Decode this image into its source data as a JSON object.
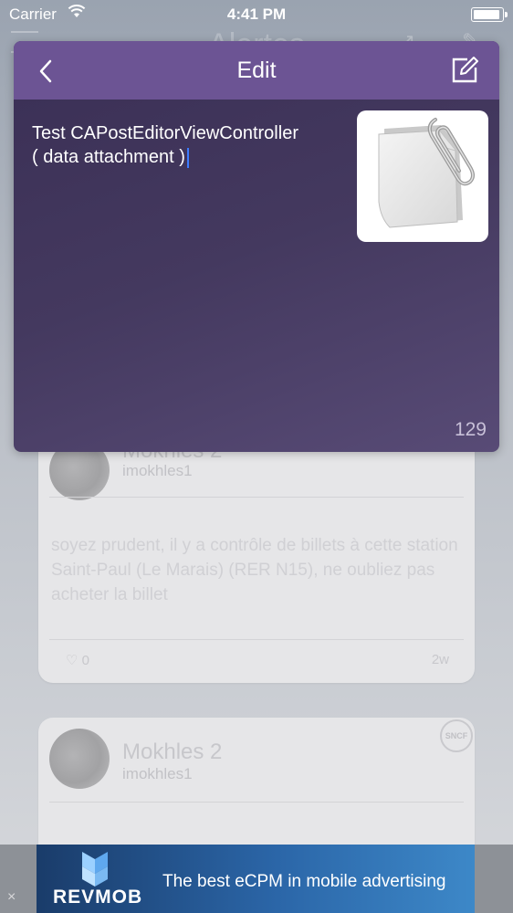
{
  "status_bar": {
    "carrier": "Carrier",
    "time": "4:41 PM"
  },
  "background": {
    "title": "Alertes",
    "cards": [
      {
        "author": "Mokhles 2",
        "handle": "imokhles1",
        "text": "soyez prudent, il y a contrôle de billets à cette station Saint-Paul (Le Marais) (RER N15), ne oubliez pas acheter la billet",
        "likes": "0",
        "age": "2w"
      },
      {
        "author": "Mokhles 2",
        "handle": "imokhles1",
        "badge": "SNCF"
      }
    ]
  },
  "editor": {
    "title": "Edit",
    "text_line1": "Test CAPostEditorViewController",
    "text_line2": "( data attachment )",
    "char_count": "129"
  },
  "ad": {
    "brand": "REVMOB",
    "tagline": "The best eCPM in mobile advertising",
    "close": "×"
  },
  "colors": {
    "header": "#6c5494",
    "editor_bg": "#44395f",
    "caret": "#3d7cff"
  }
}
